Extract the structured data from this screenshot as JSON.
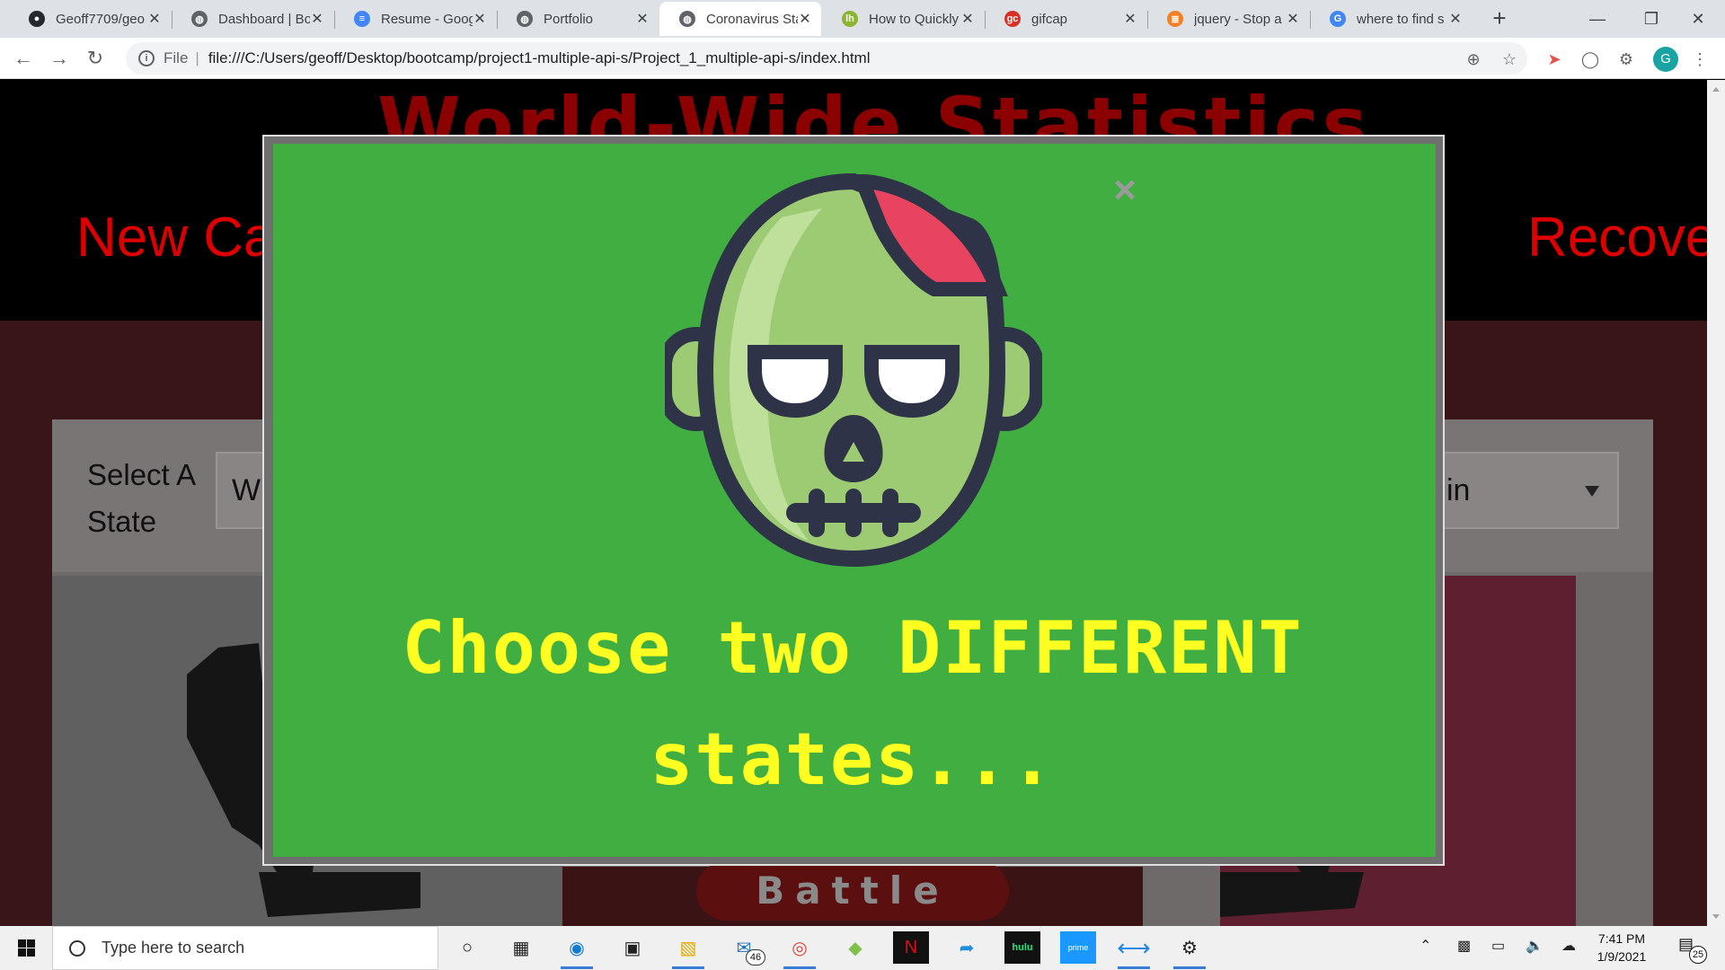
{
  "browser": {
    "tabs": [
      {
        "title": "Geoff7709/geo",
        "favicon": "github-icon",
        "color": "#24292e",
        "active": false
      },
      {
        "title": "Dashboard | Bo",
        "favicon": "globe-icon",
        "color": "#5f6368",
        "active": false
      },
      {
        "title": "Resume - Goog",
        "favicon": "google-docs-icon",
        "color": "#4285f4",
        "active": false
      },
      {
        "title": "Portfolio",
        "favicon": "globe-icon",
        "color": "#5f6368",
        "active": false
      },
      {
        "title": "Coronavirus Sta",
        "favicon": "globe-icon",
        "color": "#5f6368",
        "active": true
      },
      {
        "title": "How to Quickly",
        "favicon": "lh-icon",
        "color": "#8bb532",
        "active": false
      },
      {
        "title": "gifcap",
        "favicon": "gc-icon",
        "color": "#d93025",
        "active": false
      },
      {
        "title": "jquery - Stop a",
        "favicon": "stackoverflow-icon",
        "color": "#f48024",
        "active": false
      },
      {
        "title": "where to find s",
        "favicon": "google-icon",
        "color": "#4285f4",
        "active": false
      }
    ],
    "address": {
      "scheme_label": "File",
      "url": "file:///C:/Users/geoff/Desktop/bootcamp/project1-multiple-api-s/Project_1_multiple-api-s/index.html"
    },
    "profile_initial": "G"
  },
  "page": {
    "title": "World-Wide Statistics",
    "stat_new_label": "New Ca",
    "stat_recovered_label": "Recove",
    "select_label": "Select A State",
    "select_left_value": "W",
    "select_right_value": "in",
    "battle_label": "Battle"
  },
  "modal": {
    "close_glyph": "×",
    "message": "Choose two DIFFERENT states...",
    "background_color": "#41ae41",
    "text_color": "#ffff22"
  },
  "taskbar": {
    "search_placeholder": "Type here to search",
    "mail_badge": "46",
    "time": "7:41 PM",
    "date": "1/9/2021",
    "notification_count": "25"
  }
}
